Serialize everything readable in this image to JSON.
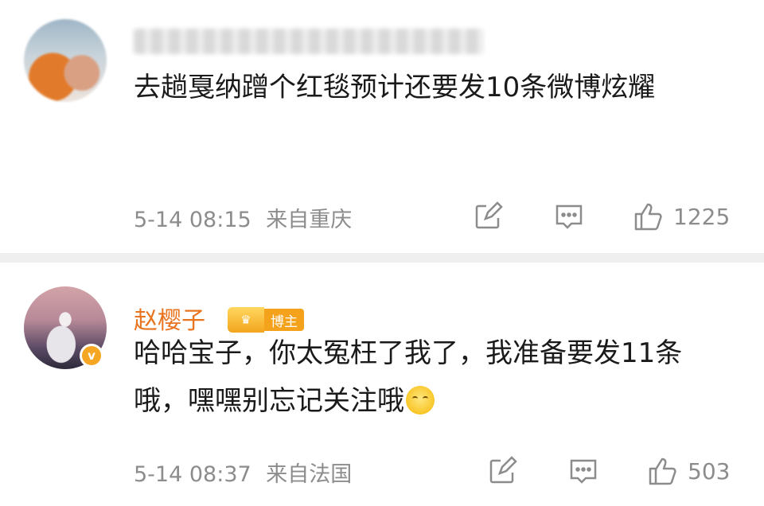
{
  "comments": [
    {
      "text": "去趟戛纳蹭个红毯预计还要发10条微博炫耀",
      "time": "5-14 08:15",
      "location": "来自重庆",
      "likes": "1225"
    },
    {
      "username": "赵樱子",
      "badge": "博主",
      "text": "哈哈宝子，你太冤枉了我了，我准备要发11条哦，嘿嘿别忘记关注哦",
      "time": "5-14 08:37",
      "location": "来自法国",
      "likes": "503"
    }
  ],
  "icons": {
    "share": "share-icon",
    "comment": "comment-icon",
    "like": "thumbs-up-icon",
    "verified": "verified-badge-icon",
    "emoji": "grinning-emoji-icon"
  },
  "colors": {
    "username": "#e8741f",
    "meta": "#8c8c8c",
    "badge": "#f4a21c",
    "divider": "#efefef"
  }
}
